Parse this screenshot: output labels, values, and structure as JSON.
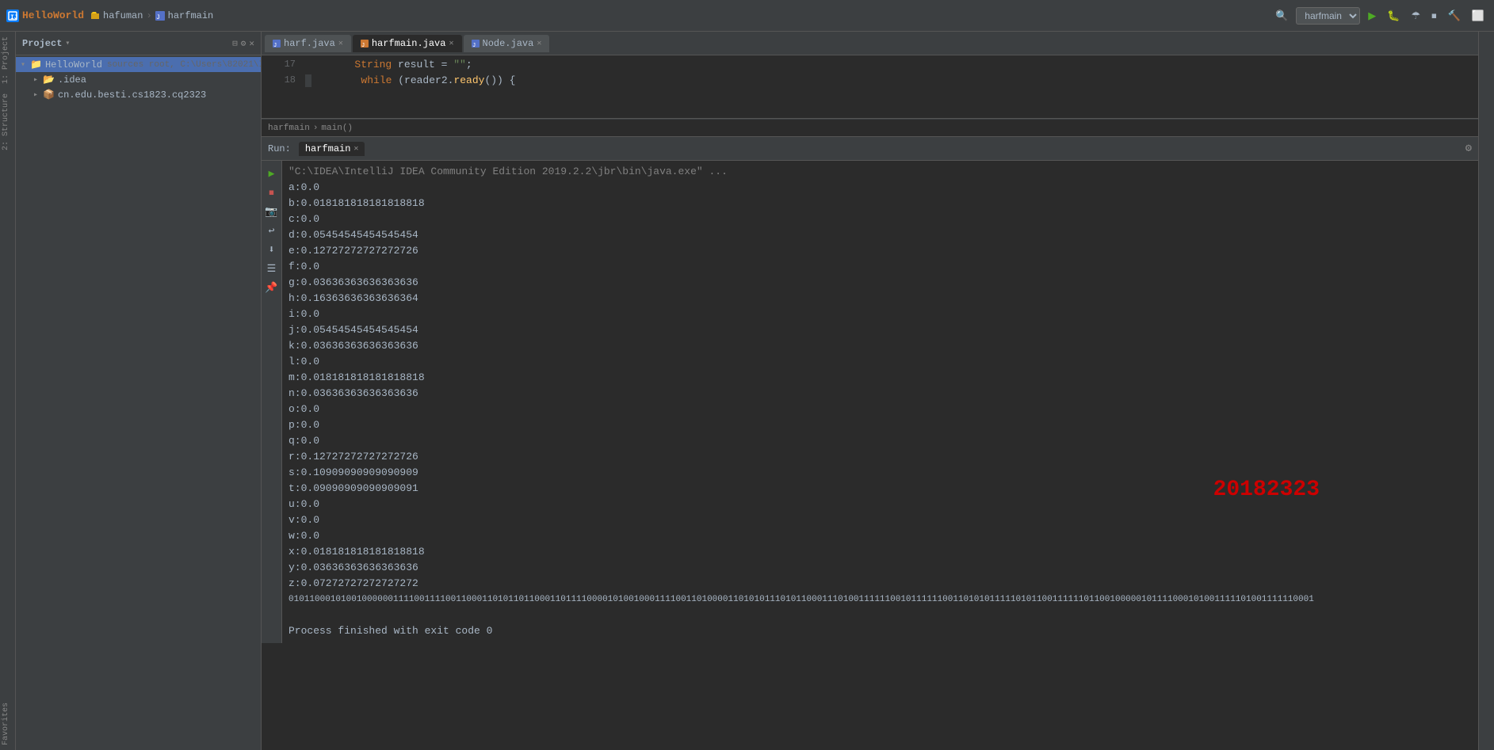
{
  "app": {
    "title": "HelloWorld",
    "breadcrumb": [
      "hafuman",
      "harfmain"
    ],
    "run_config": "harfmain"
  },
  "tabs_top": [
    {
      "label": "harf.java",
      "active": false,
      "icon": "java"
    },
    {
      "label": "harfmain.java",
      "active": true,
      "icon": "java"
    },
    {
      "label": "Node.java",
      "active": false,
      "icon": "java"
    }
  ],
  "project_tree": {
    "root": {
      "name": "HelloWorld",
      "hint": "sources root, C:\\Users\\82021\\IdeaProjects\\HelloWorld",
      "children": [
        {
          "name": ".idea",
          "type": "folder"
        },
        {
          "name": "cn.edu.besti.cs1823.cq2323",
          "type": "package"
        }
      ]
    }
  },
  "editor": {
    "lines": [
      {
        "num": "17",
        "code": "        String result = \"\";"
      },
      {
        "num": "18",
        "code": "        while (reader2.ready()) {"
      }
    ],
    "breadcrumb": "harfmain  ›  main()"
  },
  "run_panel": {
    "tab_label": "harfmain",
    "command_line": "\"C:\\IDEA\\IntelliJ IDEA Community Edition 2019.2.2\\jbr\\bin\\java.exe\" ...",
    "output_lines": [
      "a:0.0",
      "b:0.018181818181818818",
      "c:0.0",
      "d:0.05454545454545454",
      "e:0.12727272727272726",
      "f:0.0",
      "g:0.03636363636363636",
      "h:0.16363636363636364",
      "i:0.0",
      "j:0.05454545454545454",
      "k:0.03636363636363636",
      "l:0.0",
      "m:0.018181818181818818",
      "n:0.03636363636363636",
      "o:0.0",
      "p:0.0",
      "q:0.0",
      "r:0.12727272727272726",
      "s:0.10909090909090909",
      "t:0.09090909090909091",
      "u:0.0",
      "v:0.0",
      "w:0.0",
      "x:0.018181818181818818",
      "y:0.03636363636363636",
      "z:0.07272727272727272",
      "0101100010100100000011110011110011000110101101100011011110000101001000111100110100001101010111010110001110100111111001011111100110101011111010110011111101100100000101111000101001111101001111110001",
      ""
    ],
    "big_number": "20182323",
    "process_finished": "Process finished with exit code 0"
  },
  "left_strip_labels": [
    "1:Project",
    "2:Structure",
    "Favorites"
  ],
  "right_strip_labels": []
}
